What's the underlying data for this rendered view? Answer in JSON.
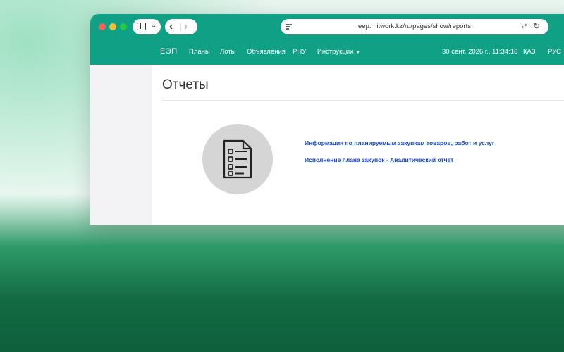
{
  "browser": {
    "url": "eep.mitwork.kz/ru/pages/show/reports"
  },
  "navbar": {
    "brand": "ЕЭП",
    "items": [
      "Планы",
      "Лоты",
      "Объявления",
      "РНУ",
      "Инструкции"
    ],
    "datetime": "30 сент. 2026 г., 11:34:16",
    "lang_kz": "ҚАЗ",
    "lang_ru": "РУС"
  },
  "page": {
    "title": "Отчеты",
    "links": [
      "Информация по планируемым закупкам товаров, работ и услуг",
      "Исполнение плана закупок - Аналитический отчет"
    ]
  },
  "colors": {
    "accent": "#0fa085",
    "link": "#1a45c9"
  },
  "icons": {
    "report": "report-document-icon"
  }
}
